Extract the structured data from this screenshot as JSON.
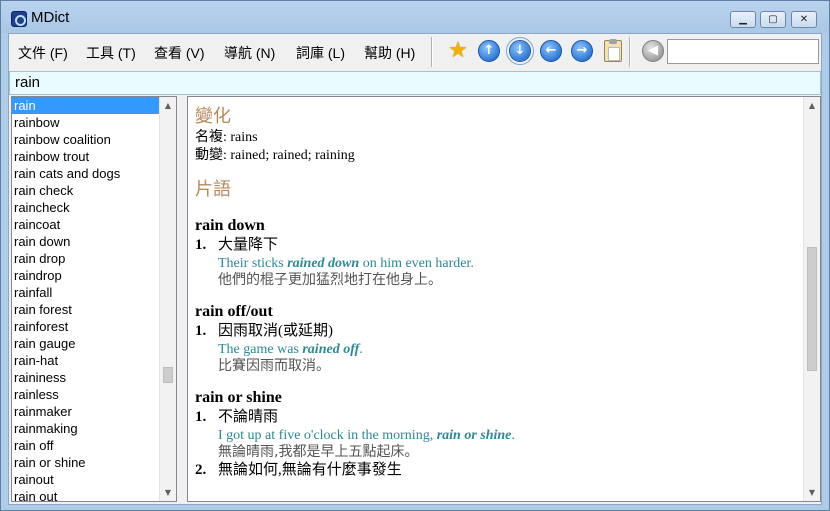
{
  "window": {
    "title": "MDict"
  },
  "menu": [
    "文件 (F)",
    "工具 (T)",
    "查看 (V)",
    "導航 (N)",
    "詞庫 (L)",
    "幫助 (H)"
  ],
  "toolbar": {
    "icons": [
      "star-icon",
      "arrow-up-icon",
      "arrow-down-icon",
      "back-icon",
      "forward-icon",
      "clipboard-icon",
      "speaker-icon"
    ],
    "search_value": ""
  },
  "query": "rain",
  "word_list": {
    "selected_index": 0,
    "items": [
      "rain",
      "rainbow",
      "rainbow coalition",
      "rainbow trout",
      "rain cats and dogs",
      "rain check",
      "raincheck",
      "raincoat",
      "rain down",
      "rain drop",
      "raindrop",
      "rainfall",
      "rain forest",
      "rainforest",
      "rain gauge",
      "rain-hat",
      "raininess",
      "rainless",
      "rainmaker",
      "rainmaking",
      "rain off",
      "rain or shine",
      "rainout",
      "rain out"
    ]
  },
  "entry": {
    "forms_heading": "變化",
    "forms": [
      "名複: rains",
      "動變: rained; rained; raining"
    ],
    "phrases_heading": "片語",
    "phrases": [
      {
        "head": "rain down",
        "senses": [
          {
            "num": "1.",
            "def": "大量降下",
            "examples": [
              {
                "en_before": "Their sticks ",
                "en_bold": "rained down",
                "en_after": " on him even harder.",
                "zh": "他們的棍子更加猛烈地打在他身上。"
              }
            ]
          }
        ]
      },
      {
        "head": "rain off/out",
        "senses": [
          {
            "num": "1.",
            "def": "因雨取消(或延期)",
            "examples": [
              {
                "en_before": "The game was ",
                "en_bold": "rained off",
                "en_after": ".",
                "zh": "比賽因雨而取消。"
              }
            ]
          }
        ]
      },
      {
        "head": "rain or shine",
        "senses": [
          {
            "num": "1.",
            "def": "不論晴雨",
            "examples": [
              {
                "en_before": "I got up at five o'clock in the morning, ",
                "en_bold": "rain or shine",
                "en_after": ".",
                "zh": "無論晴雨,我都是早上五點起床。"
              }
            ]
          },
          {
            "num": "2.",
            "def": "無論如何,無論有什麼事發生",
            "examples": []
          }
        ]
      }
    ]
  },
  "colors": {
    "accent_heading": "#b58a5b",
    "example_en": "#2a8a92",
    "selection": "#3399ff",
    "query_bg": "#e9fbff"
  }
}
